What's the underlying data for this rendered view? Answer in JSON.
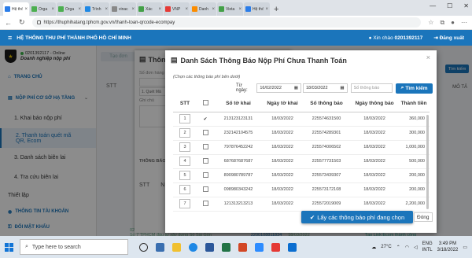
{
  "browser": {
    "tabs": [
      {
        "label": "Hệ thố",
        "color": "#2b7de9",
        "active": true
      },
      {
        "label": "Orga",
        "color": "#4caf50",
        "active": false
      },
      {
        "label": "Orga",
        "color": "#4caf50",
        "active": false
      },
      {
        "label": "Trình",
        "color": "#1e88e5",
        "active": false
      },
      {
        "label": "vinac",
        "color": "#888888",
        "active": false
      },
      {
        "label": "Xác",
        "color": "#43a047",
        "active": false
      },
      {
        "label": "VNP",
        "color": "#e53935",
        "active": false
      },
      {
        "label": "Danh",
        "color": "#fb8c00",
        "active": false
      },
      {
        "label": "Vieta",
        "color": "#43a047",
        "active": false
      },
      {
        "label": "Hệ thố",
        "color": "#2b7de9",
        "active": false
      }
    ],
    "new_tab": "+",
    "url": "https://thuphihatang.tphcm.gov.vn/thanh-toan-qrcode-ecompay"
  },
  "header": {
    "title": "HỆ THỐNG THU PHÍ THÀNH PHỐ HỒ CHÍ MINH",
    "welcome_prefix": "Xin chào",
    "user_code": "0201392117",
    "logout": "Đăng xuất"
  },
  "sidebar": {
    "user_id": "0201392117 - Online",
    "user_type": "Doanh nghiệp nộp phí",
    "home": "TRANG CHỦ",
    "section": "NỘP PHÍ CƠ SỞ HẠ TẦNG",
    "items": [
      {
        "label": "1. Khai báo nộp phí",
        "active": false
      },
      {
        "label": "2. Thanh toán quét mã QR, Ecom",
        "active": true
      },
      {
        "label": "3. Danh sách biên lai",
        "active": false
      },
      {
        "label": "4. Tra cứu biên lai",
        "active": false
      }
    ],
    "settings": "Thiết lập",
    "account": "THÔNG TIN TÀI KHOẢN",
    "change_password": "ĐỔI MẬT KHẨU"
  },
  "background": {
    "create_btn": "Tạo đơn",
    "search_btn": "Tìm kiếm",
    "stt": "STT",
    "mo_ta": "MÔ TẢ",
    "footer_code": "0201392117",
    "footer_text": "Số 7 TPHCM đầu tư xây dựng Số Sài Gòn",
    "footer_num": "2200108811834",
    "footer_date": "18/03/2022",
    "footer_status": "Tạo Link Ecom thành công"
  },
  "modal_info": {
    "title": "Thông",
    "field_label": "Số đơn hàng",
    "select_value": "1. Quét Mã",
    "note_label": "Ghi chú",
    "section": "THÔNG BÁO NỘP",
    "stt": "STT",
    "col_n": "N"
  },
  "dialog": {
    "title": "Danh Sách Thông Báo Nộp Phí Chưa Thanh Toán",
    "hint": "(Chọn các thông báo phí bên dưới)",
    "from_label": "Từ ngày:",
    "from_date": "16/02/2022",
    "to_date": "18/03/2022",
    "number_placeholder": "Số thông báo",
    "search_btn": "Tìm kiếm",
    "columns": [
      "STT",
      "",
      "Số tờ khai",
      "Ngày tờ khai",
      "Số thông báo",
      "Ngày thông báo",
      "Thành tiền"
    ],
    "rows": [
      {
        "stt": "1",
        "checked": true,
        "tk": "213123123131",
        "ntk": "18/03/2022",
        "tb": "225574631500",
        "ntb": "18/03/2022",
        "amount": "360,000"
      },
      {
        "stt": "2",
        "checked": false,
        "tk": "232142104575",
        "ntk": "18/03/2022",
        "tb": "225574289301",
        "ntb": "18/03/2022",
        "amount": "300,000"
      },
      {
        "stt": "3",
        "checked": false,
        "tk": "797876452242",
        "ntk": "18/03/2022",
        "tb": "225574006502",
        "ntb": "18/03/2022",
        "amount": "1,000,000"
      },
      {
        "stt": "4",
        "checked": false,
        "tk": "687687687687",
        "ntk": "18/03/2022",
        "tb": "225577731503",
        "ntb": "18/03/2022",
        "amount": "500,000"
      },
      {
        "stt": "5",
        "checked": false,
        "tk": "890980789787",
        "ntk": "18/03/2022",
        "tb": "225573439307",
        "ntb": "18/03/2022",
        "amount": "200,000"
      },
      {
        "stt": "6",
        "checked": false,
        "tk": "098980343242",
        "ntk": "18/03/2022",
        "tb": "225573172108",
        "ntb": "18/03/2022",
        "amount": "200,000"
      },
      {
        "stt": "7",
        "checked": false,
        "tk": "121313213213",
        "ntk": "18/03/2022",
        "tb": "225572019009",
        "ntb": "18/03/2022",
        "amount": "2,200,000"
      }
    ],
    "select_btn": "Lấy các thông báo phí đang chọn",
    "close_btn": "Đóng"
  },
  "taskbar": {
    "search_placeholder": "Type here to search",
    "weather": "27°C",
    "lang_top": "ENG",
    "lang_bottom": "INTL",
    "time": "3:49 PM",
    "date": "3/18/2022"
  }
}
